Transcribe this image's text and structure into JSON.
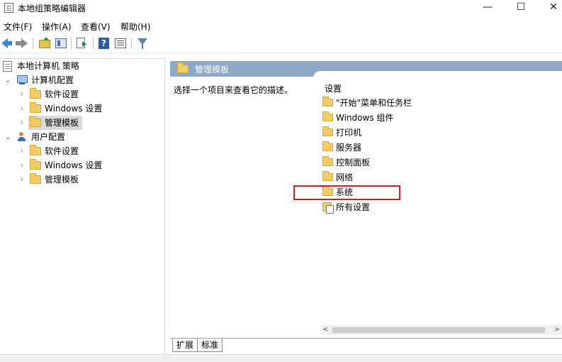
{
  "window": {
    "title": "本地组策略编辑器",
    "controls": {
      "minimize": "—",
      "maximize": "☐",
      "close": "✕"
    }
  },
  "menu": [
    {
      "label": "文件(F)"
    },
    {
      "label": "操作(A)"
    },
    {
      "label": "查看(V)"
    },
    {
      "label": "帮助(H)"
    }
  ],
  "toolbar": {
    "icons": [
      "back-arrow-icon",
      "forward-arrow-icon",
      "folder-up-icon",
      "show-hide-pane-icon",
      "export-list-icon",
      "help-icon",
      "properties-icon",
      "filter-icon"
    ]
  },
  "tree": {
    "root": "本地计算机 策略",
    "computer_config": {
      "label": "计算机配置",
      "children": [
        "软件设置",
        "Windows 设置",
        "管理模板"
      ],
      "selected_child": "管理模板"
    },
    "user_config": {
      "label": "用户配置",
      "children": [
        "软件设置",
        "Windows 设置",
        "管理模板"
      ]
    }
  },
  "right_pane": {
    "header": "管理模板",
    "description": "选择一个项目来查看它的描述。",
    "list_header": "设置",
    "items": [
      {
        "label": "\"开始\"菜单和任务栏",
        "icon": "folder-icon"
      },
      {
        "label": "Windows 组件",
        "icon": "folder-icon"
      },
      {
        "label": "打印机",
        "icon": "folder-icon"
      },
      {
        "label": "服务器",
        "icon": "folder-icon"
      },
      {
        "label": "控制面板",
        "icon": "folder-icon"
      },
      {
        "label": "网络",
        "icon": "folder-icon"
      },
      {
        "label": "系统",
        "icon": "folder-icon",
        "highlighted": true
      },
      {
        "label": "所有设置",
        "icon": "all-settings-icon"
      }
    ],
    "highlight_color": "#cc2020",
    "header_color": "#8ea9c6"
  },
  "tabs": [
    {
      "label": "扩展",
      "active": true
    },
    {
      "label": "标准",
      "active": false
    }
  ],
  "scrollbar": {
    "left_arrow": "<",
    "right_arrow": ">"
  }
}
